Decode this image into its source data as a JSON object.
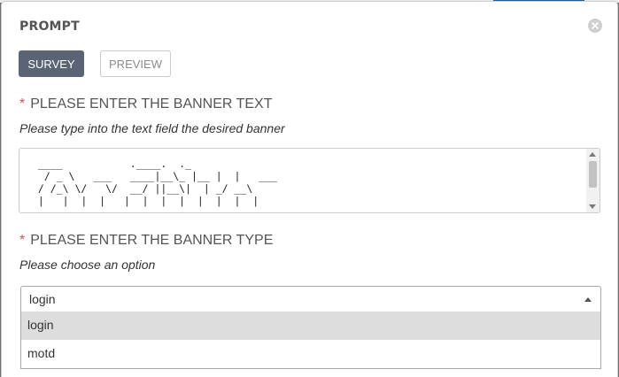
{
  "modal": {
    "title": "PROMPT"
  },
  "tabs": [
    {
      "label": "SURVEY",
      "active": true
    },
    {
      "label": "PREVIEW",
      "active": false
    }
  ],
  "questions": [
    {
      "required_mark": "*",
      "label": "PLEASE ENTER THE BANNER TEXT",
      "hint": "Please type into the text field the desired banner",
      "value_lines": [
        " ____           .____.  ._",
        "  / _ \\   ___   ____|__\\_ |__ |  |   ___",
        " / /_\\ \\/   \\/  __/ ||__\\|  | _/ __\\",
        " |   |  |  |   |  |  |  |  |  |  |  |"
      ]
    },
    {
      "required_mark": "*",
      "label": "PLEASE ENTER THE BANNER TYPE",
      "hint": "Please choose an option",
      "selected": "login",
      "options": [
        "login",
        "motd"
      ]
    }
  ],
  "colors": {
    "primary_tab": "#5a6474",
    "required": "#d9534f",
    "highlight_option": "#dddddd"
  }
}
